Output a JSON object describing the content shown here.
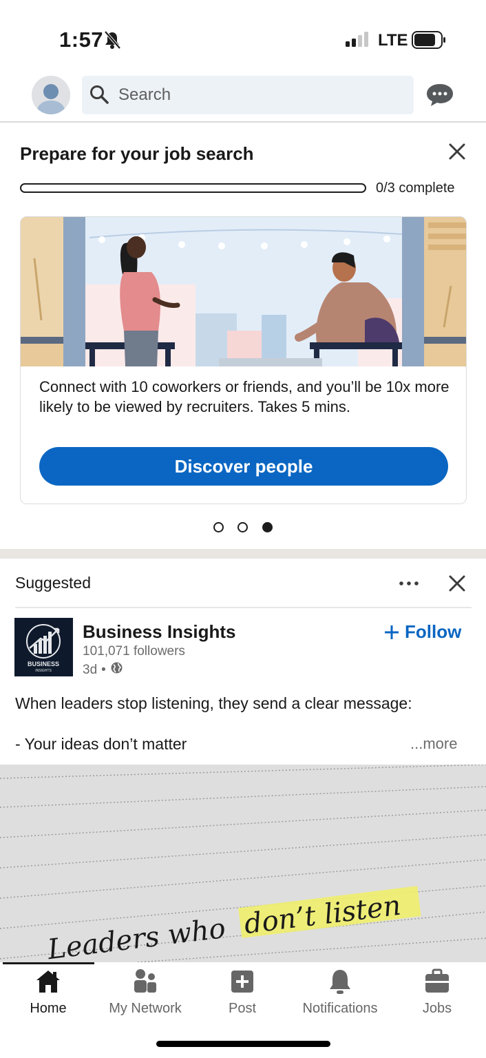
{
  "status_bar": {
    "time": "1:57",
    "carrier": "LTE",
    "icons": [
      "bell-slash-icon",
      "signal-icon",
      "battery-icon"
    ]
  },
  "top_bar": {
    "search_placeholder": "Search",
    "icons": [
      "avatar",
      "search-icon",
      "messaging-icon"
    ]
  },
  "job_search": {
    "title": "Prepare for your job search",
    "progress_label": "0/3 complete",
    "progress_fraction": 0,
    "card": {
      "body": "Connect with 10 coworkers or friends, and you’ll be 10x more likely to be viewed by recruiters. Takes 5 mins.",
      "button_label": "Discover people"
    },
    "carousel": {
      "count": 3,
      "active_index": 2
    }
  },
  "suggested_post": {
    "section_label": "Suggested",
    "author": {
      "name": "Business Insights",
      "followers": "101,071 followers",
      "age": "3d",
      "logo_text": "BUSINESS",
      "logo_subtext": "INSIGHTS"
    },
    "follow_label": "Follow",
    "text_line1": "When leaders stop listening, they send a clear message:",
    "text_line2": "- Your ideas don’t matter",
    "see_more": "...more",
    "image_text_plain": "Leaders who",
    "image_text_highlight": "don’t listen"
  },
  "bottom_nav": {
    "items": [
      {
        "label": "Home",
        "icon": "home-icon",
        "active": true
      },
      {
        "label": "My Network",
        "icon": "network-icon",
        "active": false
      },
      {
        "label": "Post",
        "icon": "post-icon",
        "active": false
      },
      {
        "label": "Notifications",
        "icon": "bell-icon",
        "active": false
      },
      {
        "label": "Jobs",
        "icon": "briefcase-icon",
        "active": false
      }
    ]
  },
  "colors": {
    "brand_blue": "#0a66c2",
    "text": "#191919",
    "muted": "#6b6b6b",
    "highlight_yellow": "#f0ee6b"
  }
}
